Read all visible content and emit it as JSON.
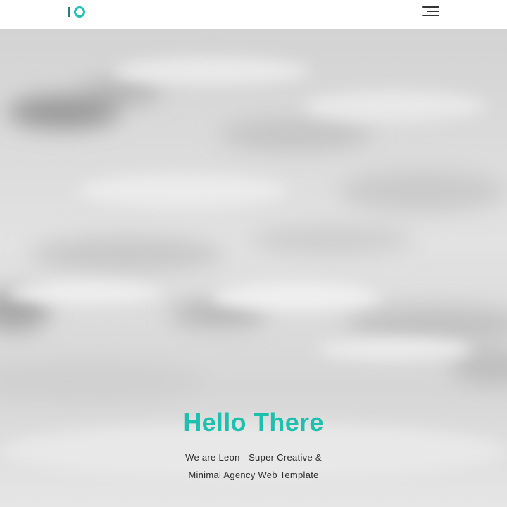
{
  "header": {
    "logo_text": "IO",
    "logo_icon": "leon-logo-icon",
    "menu_icon": "hamburger-menu-icon",
    "accent_color": "#1dbfad"
  },
  "hero": {
    "title": "Hello There",
    "subtitle_line1": "We are Leon - Super Creative &",
    "subtitle_line2": "Minimal Agency Web Template",
    "background": "cloudy-sky-grayscale"
  }
}
